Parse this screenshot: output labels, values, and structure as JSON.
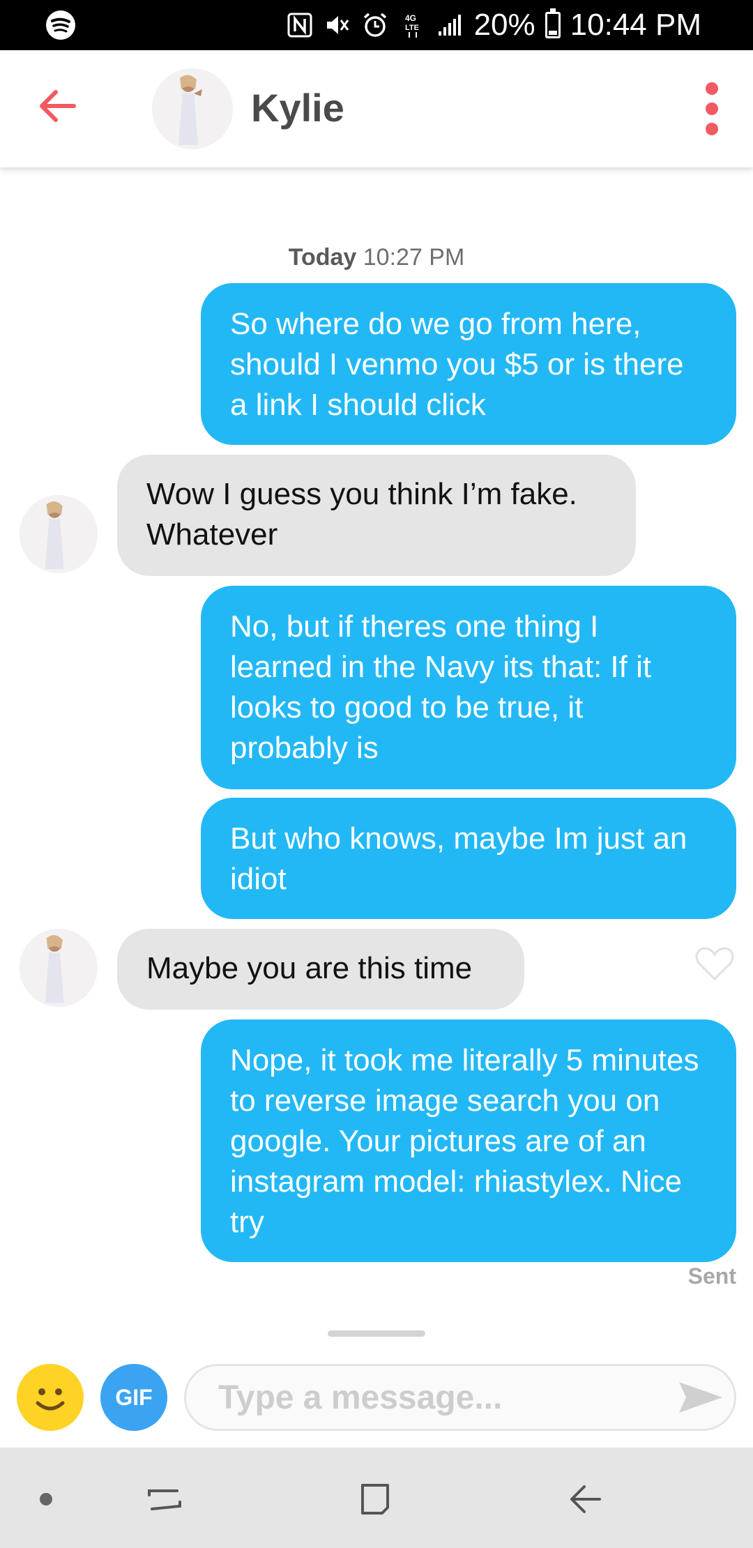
{
  "status_bar": {
    "battery": "20%",
    "time": "10:44 PM",
    "icons": [
      "spotify-icon",
      "nfc-icon",
      "mute-icon",
      "alarm-icon",
      "lte-icon",
      "signal-icon",
      "battery-icon"
    ]
  },
  "header": {
    "contact_name": "Kylie",
    "back_icon": "arrow-left-icon",
    "menu_icon": "vertical-dots-icon",
    "accent_color": "#f05a61"
  },
  "conversation": {
    "timestamp_day": "Today",
    "timestamp_time": "10:27 PM",
    "messages": [
      {
        "from": "me",
        "text": "So where do we go from here, should I venmo you $5 or is there a link I should click"
      },
      {
        "from": "them",
        "text": "Wow I guess you think I’m fake. Whatever"
      },
      {
        "from": "me",
        "text": "No, but if theres one thing I learned in the Navy its that: If it looks to good to be true, it probably is"
      },
      {
        "from": "me",
        "text": "But who knows, maybe Im just an idiot"
      },
      {
        "from": "them",
        "text": "Maybe you are this time"
      },
      {
        "from": "me",
        "text": "Nope, it took me literally 5 minutes to reverse image search you on google. Your pictures are of an instagram model: rhiastylex. Nice try"
      }
    ],
    "status": "Sent",
    "sent_bubble_color": "#22b8f6",
    "received_bubble_color": "#e5e5e5"
  },
  "composer": {
    "gif_label": "GIF",
    "placeholder": "Type a message...",
    "value": ""
  },
  "nav_bar": {
    "icons": [
      "dot-icon",
      "recent-apps-icon",
      "home-icon",
      "back-icon"
    ]
  }
}
